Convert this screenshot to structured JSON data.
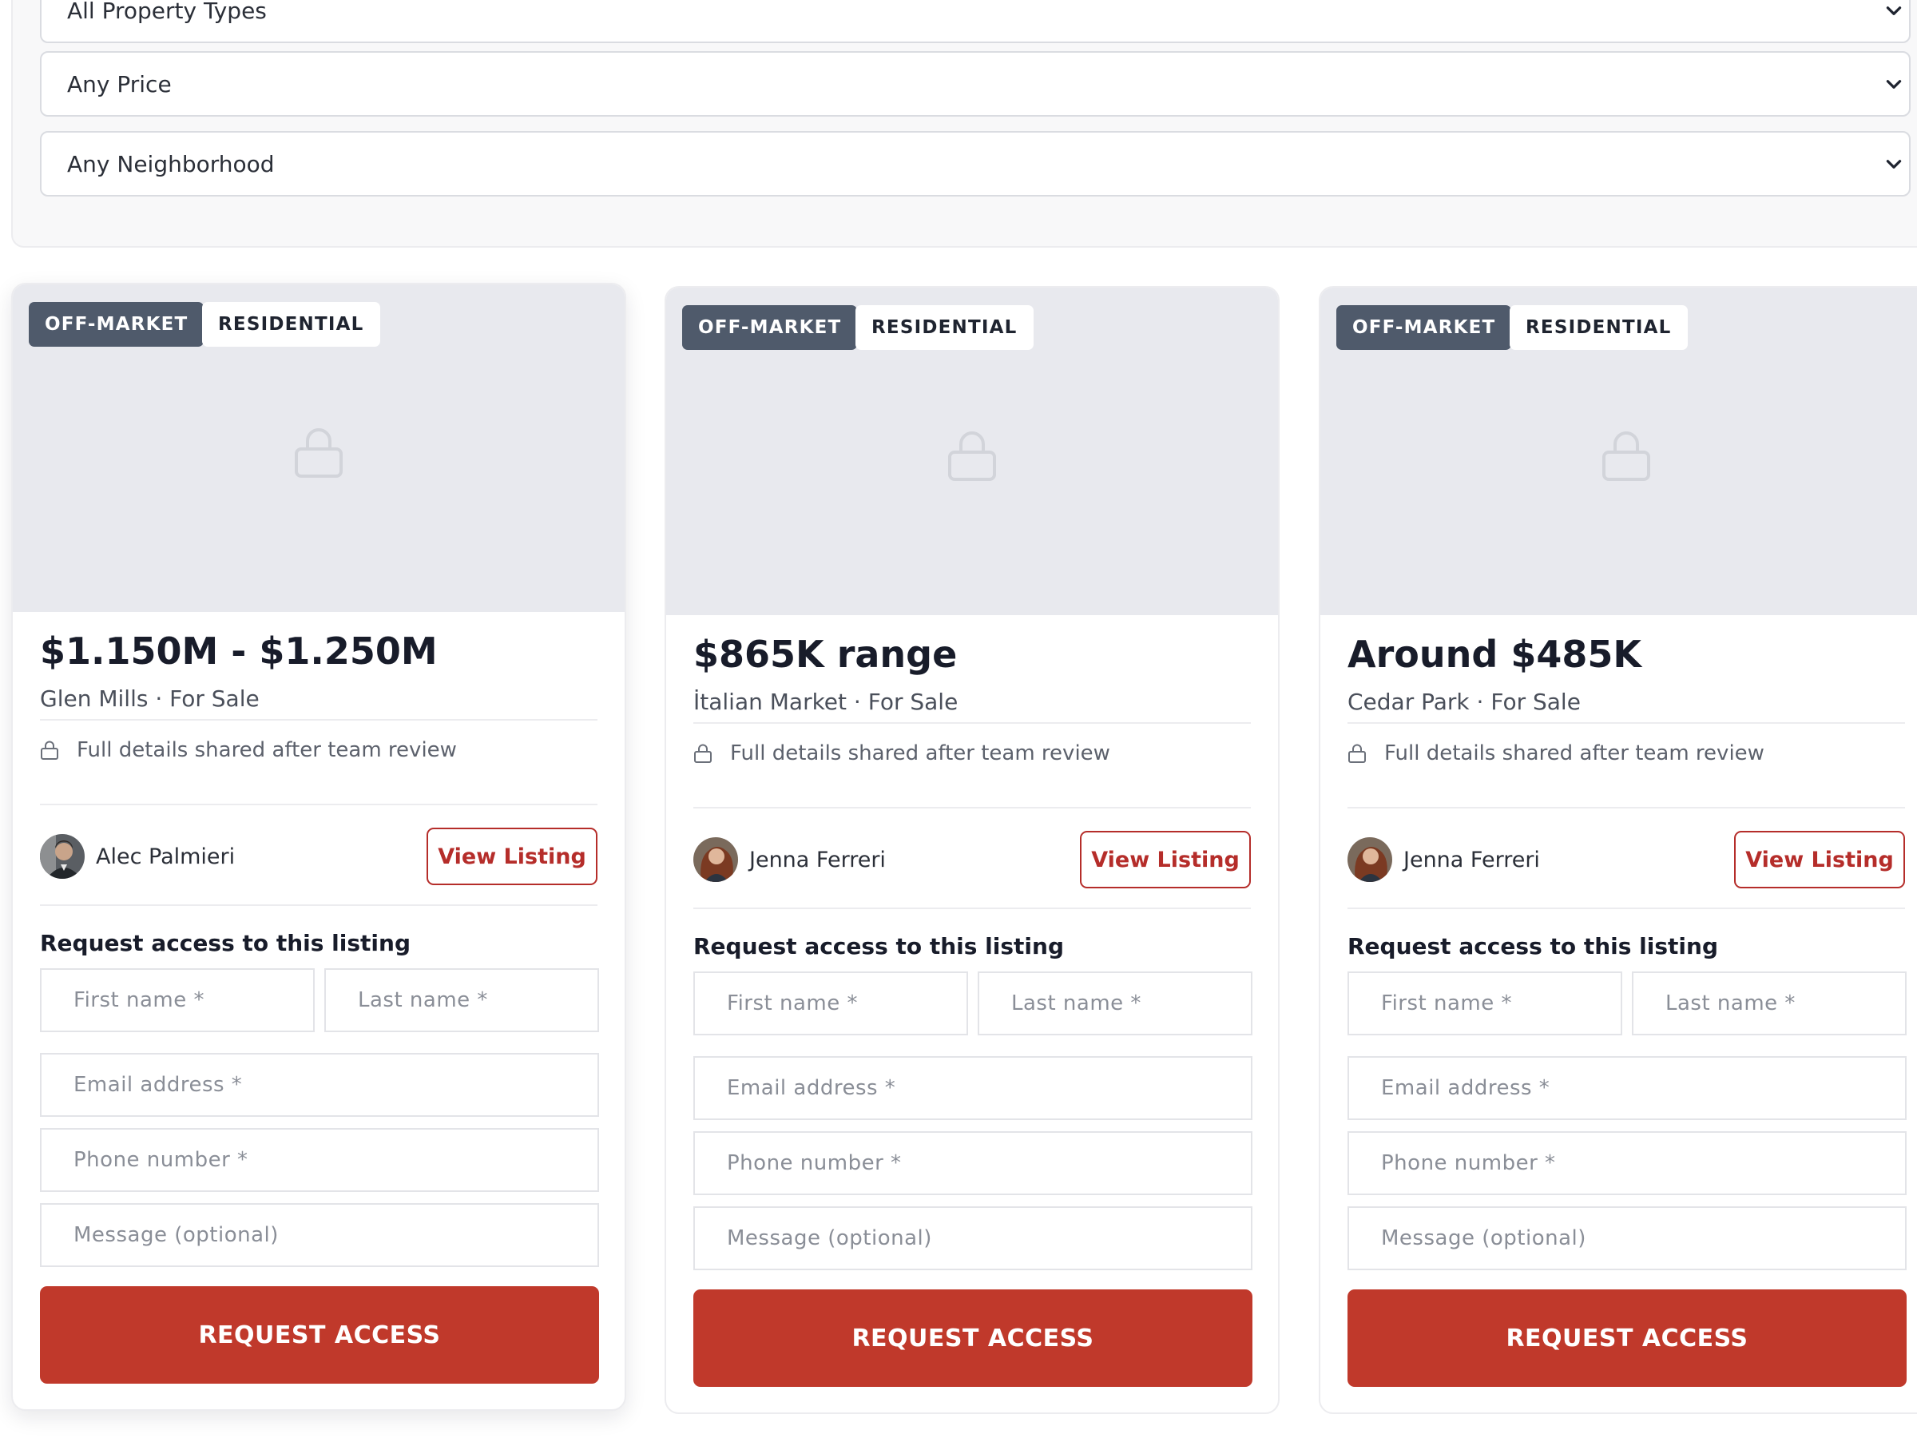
{
  "filters": {
    "property_type": "All Property Types",
    "price": "Any Price",
    "neighborhood": "Any Neighborhood"
  },
  "colors": {
    "accent_red": "#c0392b",
    "badge_dark": "#4f5a6b",
    "media_bg": "#e8e9ee"
  },
  "listings": [
    {
      "status_badge": "OFF-MARKET",
      "type_badge": "RESIDENTIAL",
      "price": "$1.150M - $1.250M",
      "location": "Glen Mills · For Sale",
      "note": "Full details shared after team review",
      "agent_name": "Alec Palmieri",
      "view_label": "View Listing",
      "form_title": "Request access to this listing",
      "first_name_placeholder": "First name *",
      "last_name_placeholder": "Last name *",
      "email_placeholder": "Email address *",
      "phone_placeholder": "Phone number *",
      "message_placeholder": "Message (optional)",
      "submit_label": "REQUEST ACCESS"
    },
    {
      "status_badge": "OFF-MARKET",
      "type_badge": "RESIDENTIAL",
      "price": "$865K range",
      "location": "İtalian Market · For Sale",
      "note": "Full details shared after team review",
      "agent_name": "Jenna Ferreri",
      "view_label": "View Listing",
      "form_title": "Request access to this listing",
      "first_name_placeholder": "First name *",
      "last_name_placeholder": "Last name *",
      "email_placeholder": "Email address *",
      "phone_placeholder": "Phone number *",
      "message_placeholder": "Message (optional)",
      "submit_label": "REQUEST ACCESS"
    },
    {
      "status_badge": "OFF-MARKET",
      "type_badge": "RESIDENTIAL",
      "price": "Around $485K",
      "location": "Cedar Park · For Sale",
      "note": "Full details shared after team review",
      "agent_name": "Jenna Ferreri",
      "view_label": "View Listing",
      "form_title": "Request access to this listing",
      "first_name_placeholder": "First name *",
      "last_name_placeholder": "Last name *",
      "email_placeholder": "Email address *",
      "phone_placeholder": "Phone number *",
      "message_placeholder": "Message (optional)",
      "submit_label": "REQUEST ACCESS"
    }
  ]
}
